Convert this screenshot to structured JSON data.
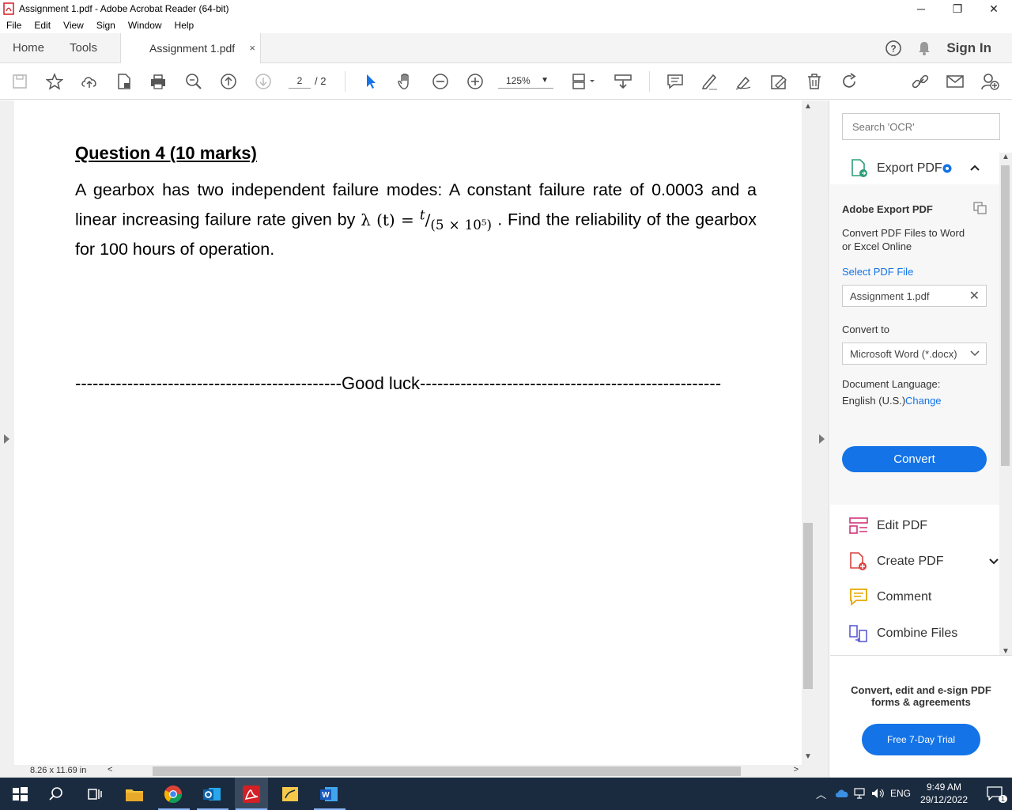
{
  "window": {
    "title": "Assignment 1.pdf - Adobe Acrobat Reader (64-bit)",
    "minimize": "─",
    "maximize": "❐",
    "close": "✕"
  },
  "menu": [
    "File",
    "Edit",
    "View",
    "Sign",
    "Window",
    "Help"
  ],
  "tabs": {
    "home": "Home",
    "tools": "Tools",
    "document": "Assignment 1.pdf",
    "close": "×",
    "sign_in": "Sign In"
  },
  "toolbar": {
    "page_current": "2",
    "page_total": "/ 2",
    "zoom": "125%"
  },
  "document": {
    "question_title": "Question 4 (10 marks)",
    "body_part1": "A gearbox has two independent failure modes: A constant failure rate of 0.0003 and a linear increasing failure rate given by",
    "formula_lhs": "λ (t) =",
    "formula_num": "t",
    "formula_den": "(5 × 10⁵)",
    "body_part2": ". Find the reliability of the gearbox for 100 hours of operation.",
    "footer": "----------------------------------------------Good luck----------------------------------------------------"
  },
  "status": {
    "page_size": "8.26 x 11.69 in"
  },
  "sidepanel": {
    "search_placeholder": "Search 'OCR'",
    "export_title": "Export PDF",
    "export_heading": "Adobe Export PDF",
    "export_desc": "Convert PDF Files to Word or Excel Online",
    "select_file_label": "Select PDF File",
    "selected_file": "Assignment 1.pdf",
    "convert_to_label": "Convert to",
    "convert_to_value": "Microsoft Word (*.docx)",
    "doc_language_label": "Document Language:",
    "doc_language_value": "English (U.S.)",
    "change_link": "Change",
    "convert_button": "Convert",
    "tools": [
      "Edit PDF",
      "Create PDF",
      "Comment",
      "Combine Files"
    ],
    "promo_text": "Convert, edit and e-sign PDF forms & agreements",
    "trial_button": "Free 7-Day Trial"
  },
  "taskbar": {
    "language": "ENG",
    "time": "9:49 AM",
    "date": "29/12/2022",
    "notifications": "1"
  },
  "colors": {
    "accent": "#1473e6",
    "taskbar": "#1b2b3f"
  }
}
